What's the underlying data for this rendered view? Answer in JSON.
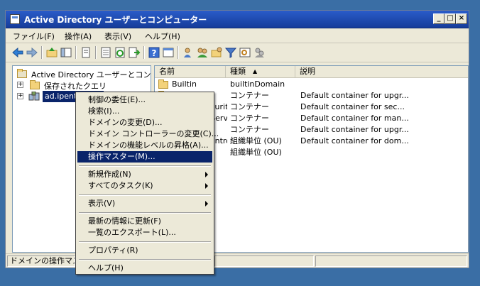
{
  "window": {
    "title": "Active Directory ユーザーとコンピューター"
  },
  "menubar": {
    "items": [
      "ファイル(F)",
      "操作(A)",
      "表示(V)",
      "ヘルプ(H)"
    ]
  },
  "toolbar": {
    "icons": [
      "back-icon",
      "forward-icon",
      "up-folder-icon",
      "show-tree-icon",
      "copy-icon",
      "properties-icon",
      "refresh-icon",
      "export-icon",
      "help-icon",
      "console-icon",
      "add-user-icon",
      "add-group-icon",
      "add-ou-icon",
      "filter-icon",
      "find-icon",
      "delegate-icon"
    ]
  },
  "tree": {
    "root": "Active Directory ユーザーとコンピュ",
    "saved_queries": "保存されたクエリ",
    "domain": "ad.ipente"
  },
  "list": {
    "headers": [
      "名前",
      "種類",
      "説明"
    ],
    "rows": [
      [
        "Builtin",
        "builtinDomain",
        ""
      ],
      [
        "Computers",
        "コンテナー",
        "Default container for upgr..."
      ],
      [
        "ForeignSecurityPrincipals",
        "コンテナー",
        "Default container for sec..."
      ],
      [
        "Managed Service Accounts",
        "コンテナー",
        "Default container for man..."
      ],
      [
        "Users",
        "コンテナー",
        "Default container for upgr..."
      ],
      [
        "Domain Controllers",
        "組織単位 (OU)",
        "Default container for dom..."
      ],
      [
        "Groups",
        "組織単位 (OU)",
        ""
      ]
    ]
  },
  "status": {
    "text": "ドメインの操作マスター"
  },
  "context_menu": {
    "items": [
      {
        "label": "制御の委任(E)...",
        "highlight": false,
        "submenu": false
      },
      {
        "label": "検索(I)...",
        "highlight": false,
        "submenu": false
      },
      {
        "label": "ドメインの変更(D)...",
        "highlight": false,
        "submenu": false
      },
      {
        "label": "ドメイン コントローラーの変更(C)...",
        "highlight": false,
        "submenu": false
      },
      {
        "label": "ドメインの機能レベルの昇格(A)...",
        "highlight": false,
        "submenu": false
      },
      {
        "label": "操作マスター(M)...",
        "highlight": true,
        "submenu": false
      },
      {
        "label": "新規作成(N)",
        "highlight": false,
        "submenu": true
      },
      {
        "label": "すべてのタスク(K)",
        "highlight": false,
        "submenu": true
      },
      {
        "label": "表示(V)",
        "highlight": false,
        "submenu": true
      },
      {
        "label": "最新の情報に更新(F)",
        "highlight": false,
        "submenu": false
      },
      {
        "label": "一覧のエクスポート(L)...",
        "highlight": false,
        "submenu": false
      },
      {
        "label": "プロパティ(R)",
        "highlight": false,
        "submenu": false
      },
      {
        "label": "ヘルプ(H)",
        "highlight": false,
        "submenu": false
      }
    ]
  }
}
